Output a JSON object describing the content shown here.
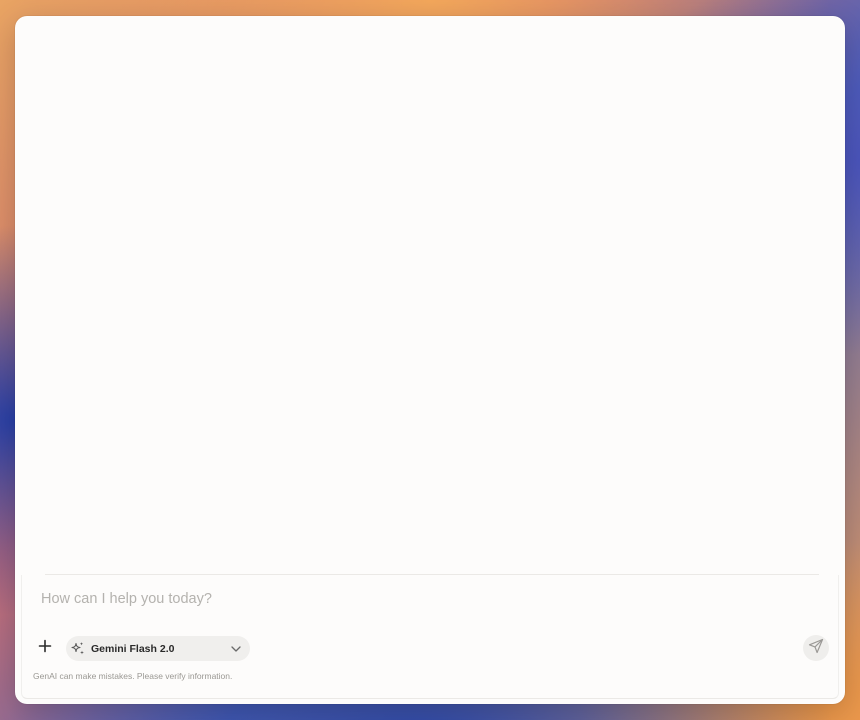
{
  "composer": {
    "placeholder": "How can I help you today?",
    "model_label": "Gemini Flash 2.0",
    "add_icon": "plus-icon",
    "model_icon": "sparkle-icon",
    "dropdown_icon": "chevron-down-icon",
    "send_icon": "send-icon",
    "disclaimer": "GenAI can make mistakes. Please verify information."
  },
  "colors": {
    "window_background": "#fdfcfb",
    "model_pill_background": "#f0efed",
    "placeholder_text": "#b4b2ae",
    "disclaimer_text": "#9a9893"
  }
}
